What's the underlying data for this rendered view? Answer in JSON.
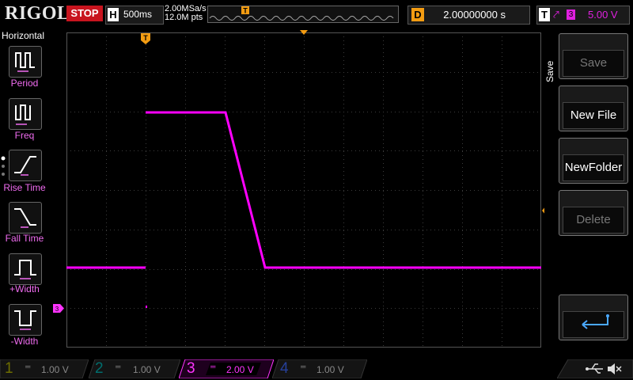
{
  "brand": "RIGOL",
  "run_state": "STOP",
  "timebase": {
    "label": "H",
    "value": "500ms"
  },
  "acquisition": {
    "sample_rate": "2.00MSa/s",
    "points": "12.0M pts"
  },
  "trigger_marker": "T",
  "delay": {
    "label": "D",
    "value": "2.00000000 s"
  },
  "trigger": {
    "label": "T",
    "source": "3",
    "level": "5.00 V"
  },
  "left_panel": {
    "title": "Horizontal",
    "items": [
      {
        "label": "Period",
        "icon": "period-icon"
      },
      {
        "label": "Freq",
        "icon": "frequency-icon"
      },
      {
        "label": "Rise Time",
        "icon": "rise-time-icon"
      },
      {
        "label": "Fall Time",
        "icon": "fall-time-icon"
      },
      {
        "label": "+Width",
        "icon": "positive-width-icon"
      },
      {
        "label": "-Width",
        "icon": "negative-width-icon"
      }
    ]
  },
  "right_panel": {
    "title": "Save",
    "buttons": [
      {
        "label": "Save",
        "enabled": false
      },
      {
        "label": "New File",
        "enabled": true
      },
      {
        "label": "NewFolder",
        "enabled": true
      },
      {
        "label": "Delete",
        "enabled": false
      }
    ],
    "return_icon": "return-arrow-icon"
  },
  "channels": [
    {
      "num": "1",
      "scale": "1.00 V",
      "color": "#c8c800",
      "active": false
    },
    {
      "num": "2",
      "scale": "1.00 V",
      "color": "#00c8c8",
      "active": false
    },
    {
      "num": "3",
      "scale": "2.00 V",
      "color": "#ff33ff",
      "active": true
    },
    {
      "num": "4",
      "scale": "1.00 V",
      "color": "#3c78ff",
      "active": false
    }
  ],
  "ch3_marker": "3",
  "trigger_level_marker": "T",
  "status_icons": [
    "usb-icon",
    "mute-icon"
  ],
  "colors": {
    "trace": "#ff00ff",
    "grid": "#3c3c3c",
    "accent": "#f39c12",
    "stop": "#c8141e"
  }
}
